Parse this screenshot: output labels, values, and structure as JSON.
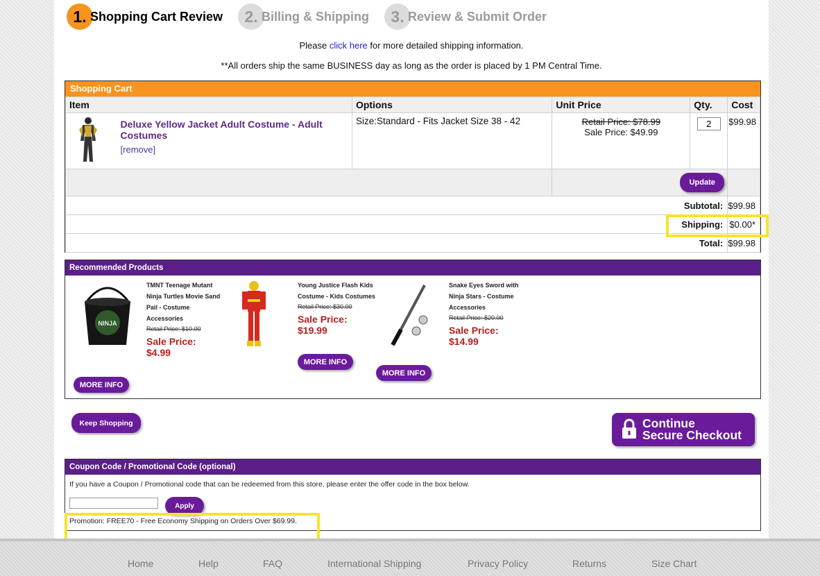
{
  "steps": [
    {
      "num": "1.",
      "label": "Shopping Cart Review"
    },
    {
      "num": "2.",
      "label": "Billing & Shipping"
    },
    {
      "num": "3.",
      "label": "Review & Submit Order"
    }
  ],
  "info": {
    "line1_pre": "Please ",
    "line1_link": "click here",
    "line1_post": " for more detailed shipping information.",
    "line2": "**All orders ship the same BUSINESS day as long as the order is placed by 1 PM Central Time."
  },
  "cart": {
    "header": "Shopping Cart",
    "columns": [
      "Item",
      "Options",
      "Unit Price",
      "Qty.",
      "Cost"
    ],
    "item": {
      "title": "Deluxe Yellow Jacket Adult Costume - Adult Costumes",
      "remove": "[remove]",
      "options": "Size:Standard - Fits Jacket Size 38 - 42",
      "retail": "Retail Price: $78.99",
      "sale": "Sale Price: $49.99",
      "qty": "2",
      "cost": "$99.98"
    },
    "update_label": "Update",
    "subtotal_label": "Subtotal:",
    "subtotal": "$99.98",
    "shipping_label": "Shipping:",
    "shipping": "$0.00*",
    "total_label": "Total:",
    "total": "$99.98"
  },
  "recommended": {
    "header": "Recommended Products",
    "more_info": "MORE INFO",
    "products": [
      {
        "name": "TMNT Teenage Mutant Ninja Turtles Movie Sand Pail - Costume Accessories",
        "retail": "Retail Price: $10.00",
        "sale_label": "Sale Price:",
        "sale": "$4.99"
      },
      {
        "name": "Young Justice Flash Kids Costume - Kids Costumes",
        "retail": "Retail Price: $30.00",
        "sale_label": "Sale Price:",
        "sale": "$19.99"
      },
      {
        "name": "Snake Eyes Sword with Ninja Stars - Costume Accessories",
        "retail": "Retail Price: $20.00",
        "sale_label": "Sale Price:",
        "sale": "$14.99"
      }
    ]
  },
  "actions": {
    "keep_shopping": "Keep Shopping",
    "checkout_line1": "Continue",
    "checkout_line2": "Secure Checkout"
  },
  "coupon": {
    "header": "Coupon Code / Promotional Code (optional)",
    "text": "If you have a Coupon / Promotional code that can be redeemed from this store, please enter the offer code in the box below.",
    "input_value": "",
    "apply": "Apply",
    "promo": "Promotion: FREE70 - Free Economy Shipping on Orders Over $69.99."
  },
  "footer": {
    "links": [
      "Home",
      "Help",
      "FAQ",
      "International Shipping",
      "Privacy Policy",
      "Returns",
      "Size Chart"
    ]
  },
  "colors": {
    "orange": "#f7931e",
    "purple": "#5b1f8a",
    "button_purple": "#6a1b9a",
    "sale_red": "#b52020",
    "highlight": "#f5e52a"
  }
}
